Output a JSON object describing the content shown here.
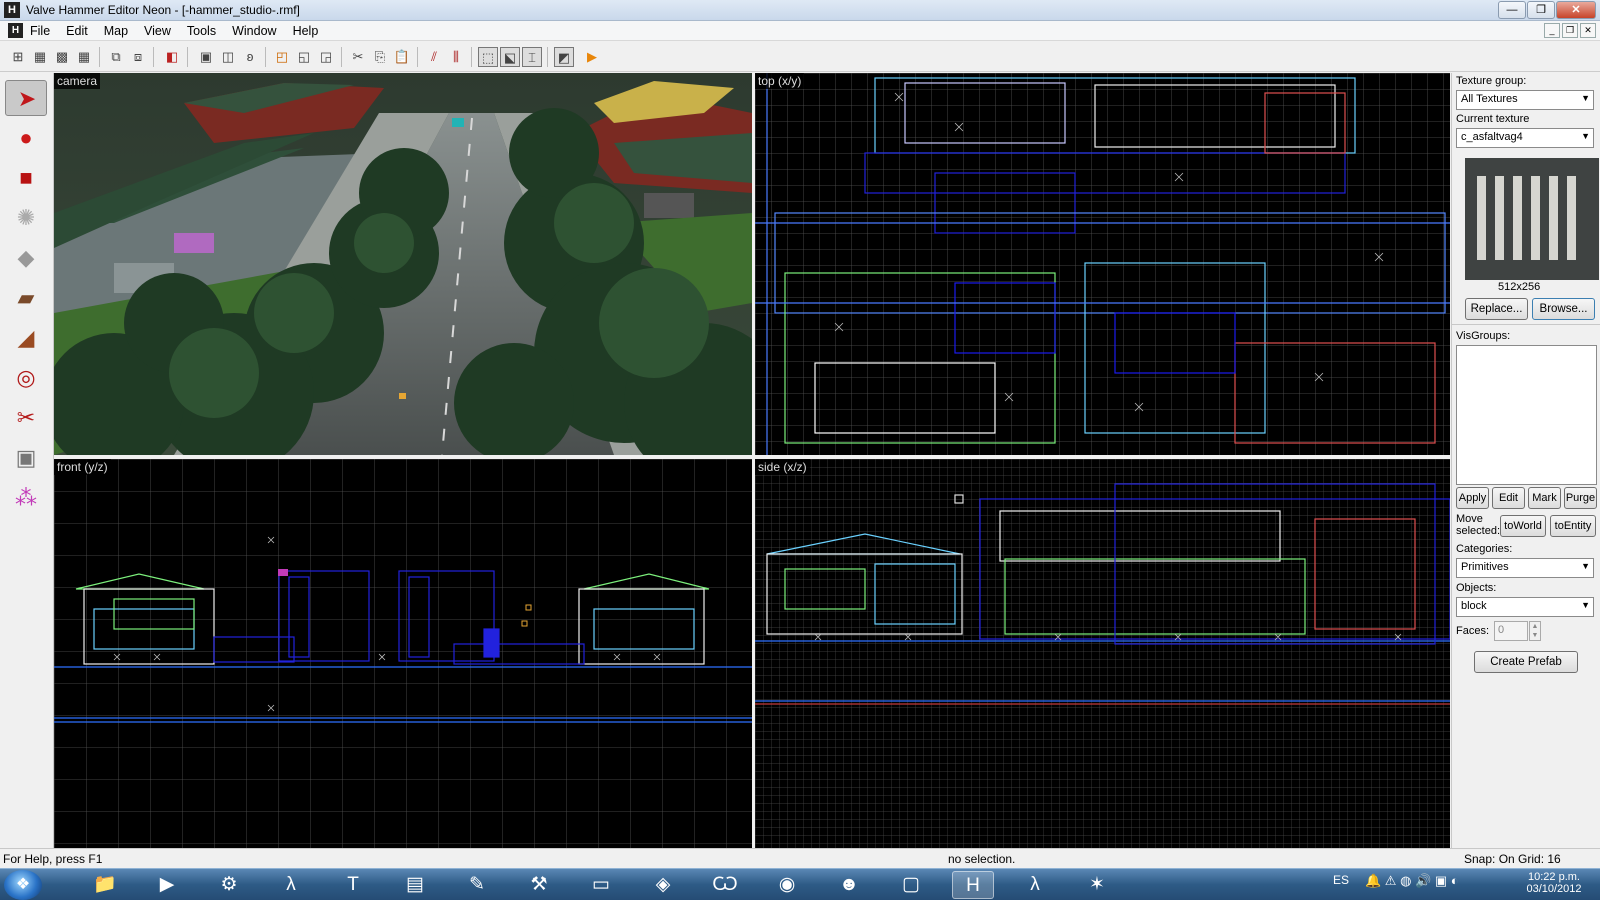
{
  "window": {
    "title": "Valve Hammer Editor Neon - [-hammer_studio-.rmf]",
    "app_icon": "H",
    "min_glyph": "—",
    "max_glyph": "❐",
    "close_glyph": "✕"
  },
  "menu": {
    "icon": "H",
    "items": [
      "File",
      "Edit",
      "Map",
      "View",
      "Tools",
      "Window",
      "Help"
    ],
    "mdi_min": "_",
    "mdi_restore": "❐",
    "mdi_close": "✕"
  },
  "toolbar": {
    "icons": [
      "grid-toggle-icon",
      "3d-grid-icon",
      "smaller-grid-icon",
      "larger-grid-icon",
      "group-icon",
      "ungroup-icon",
      "hide-icon",
      "carve-icon",
      "hollow-icon",
      "texture-lock-icon",
      "cordon-icon",
      "flip-icon",
      "rotate-icon",
      "cut-icon",
      "copy-icon",
      "paste-icon",
      "ignore-groups-icon",
      "toggle-texture-icon",
      "wireframe-icon",
      "selection-icon",
      "texture-icon",
      "toggle-helpers-icon",
      "run-map-icon"
    ]
  },
  "tools": [
    {
      "name": "selection-tool",
      "glyph": "➤",
      "color": "#c0171b",
      "active": true
    },
    {
      "name": "magnify-tool",
      "glyph": "●",
      "color": "#cc1a1a"
    },
    {
      "name": "camera-tool",
      "glyph": "■",
      "color": "#b81212"
    },
    {
      "name": "entity-tool",
      "glyph": "💡",
      "color": "#999"
    },
    {
      "name": "block-tool",
      "glyph": "◆",
      "color": "#aaa"
    },
    {
      "name": "texture-application-tool",
      "glyph": "▰",
      "color": "#7a4a2a"
    },
    {
      "name": "apply-current-texture-tool",
      "glyph": "◢",
      "color": "#9a4b22"
    },
    {
      "name": "decal-tool",
      "glyph": "◎",
      "color": "#b01818"
    },
    {
      "name": "clipping-tool",
      "glyph": "✂",
      "color": "#b51c1c"
    },
    {
      "name": "vertex-tool",
      "glyph": "▣",
      "color": "#777"
    },
    {
      "name": "path-tool",
      "glyph": "⁂",
      "color": "#c23ab8"
    }
  ],
  "viewports": {
    "camera": "camera",
    "top": "top (x/y)",
    "front": "front (y/z)",
    "side": "side (x/z)"
  },
  "panel": {
    "texture_group_label": "Texture group:",
    "texture_group_value": "All Textures",
    "current_texture_label": "Current texture",
    "current_texture_value": "c_asfaltvag4",
    "texture_size": "512x256",
    "replace": "Replace...",
    "browse": "Browse...",
    "visgroups_label": "VisGroups:",
    "apply": "Apply",
    "edit": "Edit",
    "mark": "Mark",
    "purge": "Purge",
    "move_selected": "Move selected:",
    "toworld": "toWorld",
    "toentity": "toEntity",
    "categories_label": "Categories:",
    "categories_value": "Primitives",
    "objects_label": "Objects:",
    "objects_value": "block",
    "faces_label": "Faces:",
    "faces_value": "0",
    "create_prefab": "Create Prefab",
    "dropdown_arrow": "▼"
  },
  "status": {
    "help": "For Help, press F1",
    "selection": "no selection.",
    "snap": "Snap: On Grid: 16"
  },
  "taskbar": {
    "start_glyph": "❖",
    "apps": [
      {
        "name": "explorer-taskbar-icon",
        "glyph": "📁"
      },
      {
        "name": "media-player-taskbar-icon",
        "glyph": "▶"
      },
      {
        "name": "steam-taskbar-icon",
        "glyph": "⚙"
      },
      {
        "name": "source-sdk-taskbar-icon",
        "glyph": "λ"
      },
      {
        "name": "font-tool-taskbar-icon",
        "glyph": "T"
      },
      {
        "name": "archive-taskbar-icon",
        "glyph": "▤"
      },
      {
        "name": "pipette-taskbar-icon",
        "glyph": "✎"
      },
      {
        "name": "hammer-tool-taskbar-icon",
        "glyph": "⚒"
      },
      {
        "name": "document-taskbar-icon",
        "glyph": "▭"
      },
      {
        "name": "cube-taskbar-icon",
        "glyph": "◈"
      },
      {
        "name": "winamp-taskbar-icon",
        "glyph": "Ѡ"
      },
      {
        "name": "firefox-taskbar-icon",
        "glyph": "◉"
      },
      {
        "name": "hulk-taskbar-icon",
        "glyph": "☻"
      },
      {
        "name": "box-taskbar-icon",
        "glyph": "▢"
      },
      {
        "name": "hammer-editor-taskbar-icon",
        "glyph": "H",
        "active": true
      },
      {
        "name": "half-life-taskbar-icon",
        "glyph": "λ"
      },
      {
        "name": "star-taskbar-icon",
        "glyph": "✶"
      }
    ],
    "lang": "ES",
    "time": "10:22 p.m.",
    "date": "03/10/2012"
  }
}
